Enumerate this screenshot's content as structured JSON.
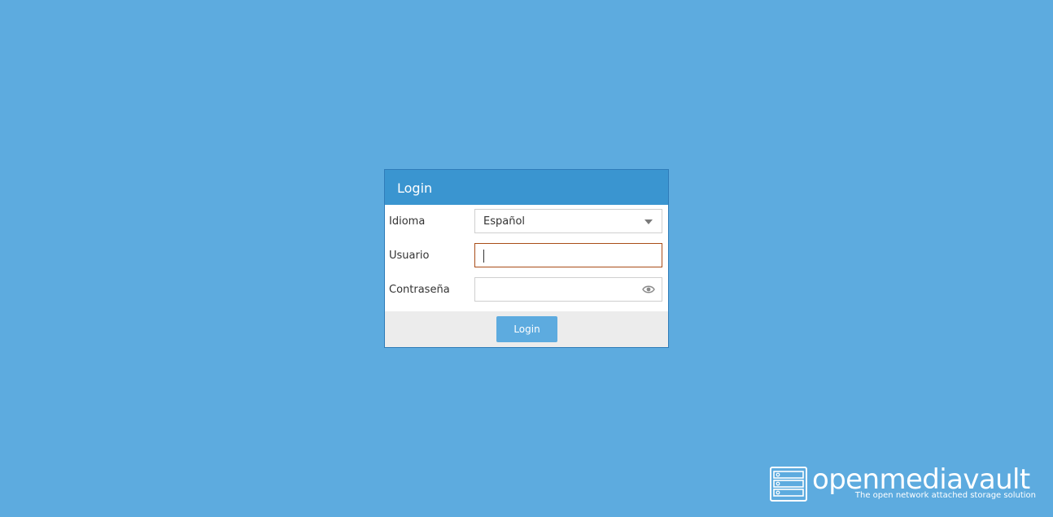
{
  "window": {
    "title": "Login"
  },
  "form": {
    "language": {
      "label": "Idioma",
      "selected": "Español"
    },
    "username": {
      "label": "Usuario",
      "value": ""
    },
    "password": {
      "label": "Contraseña",
      "value": ""
    }
  },
  "toolbar": {
    "login_label": "Login"
  },
  "brand": {
    "name": "openmediavault",
    "tagline": "The open network attached storage solution"
  },
  "icons": {
    "dropdown": "chevron-down-icon",
    "password_toggle": "eye-icon",
    "logo": "server-rack-icon"
  },
  "colors": {
    "background": "#5dabdf",
    "header": "#3a95d0",
    "focus_border": "#a94d18",
    "button": "#5dabdf"
  }
}
